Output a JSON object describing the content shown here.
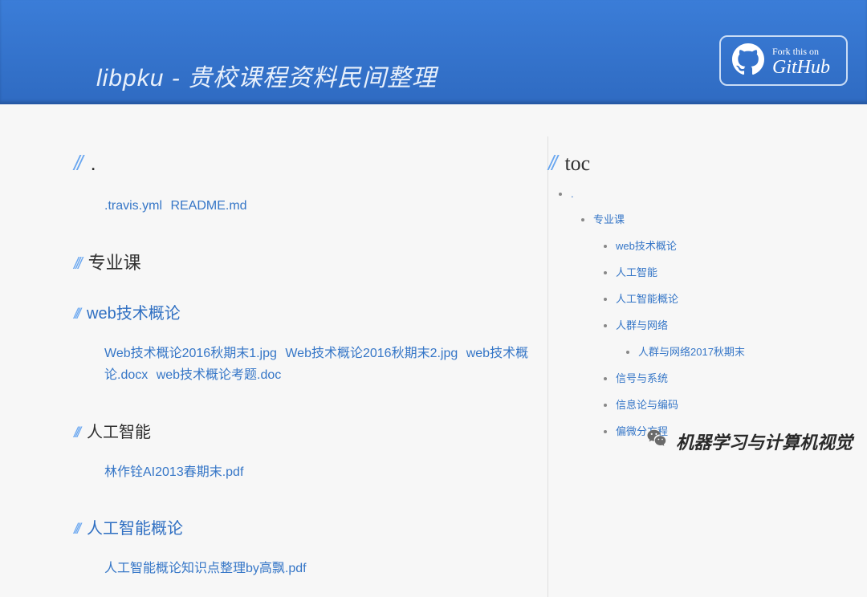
{
  "header": {
    "title_prefix": "libpku - ",
    "title_main": "贵校课程资料民间整理"
  },
  "github": {
    "small": "Fork this on",
    "big": "GitHub"
  },
  "main": {
    "root": {
      "heading": ".",
      "files": [
        ".travis.yml",
        "README.md"
      ]
    },
    "sections": [
      {
        "heading": "专业课",
        "subsections": [
          {
            "heading": "web技术概论",
            "files": [
              "Web技术概论2016秋期末1.jpg",
              "Web技术概论2016秋期末2.jpg",
              "web技术概论.docx",
              "web技术概论考题.doc"
            ]
          },
          {
            "heading": "人工智能",
            "files": [
              "林作铨AI2013春期末.pdf"
            ]
          },
          {
            "heading": "人工智能概论",
            "files": [
              "人工智能概论知识点整理by高飘.pdf"
            ]
          }
        ]
      }
    ]
  },
  "toc": {
    "heading": "toc",
    "root": ".",
    "items": [
      {
        "label": "专业课",
        "children": [
          {
            "label": "web技术概论"
          },
          {
            "label": "人工智能"
          },
          {
            "label": "人工智能概论"
          },
          {
            "label": "人群与网络",
            "children": [
              {
                "label": "人群与网络2017秋期末"
              }
            ]
          },
          {
            "label": "信号与系统"
          },
          {
            "label": "信息论与编码"
          },
          {
            "label": "偏微分方程"
          }
        ]
      }
    ]
  },
  "watermark": {
    "text": "机器学习与计算机视觉"
  }
}
